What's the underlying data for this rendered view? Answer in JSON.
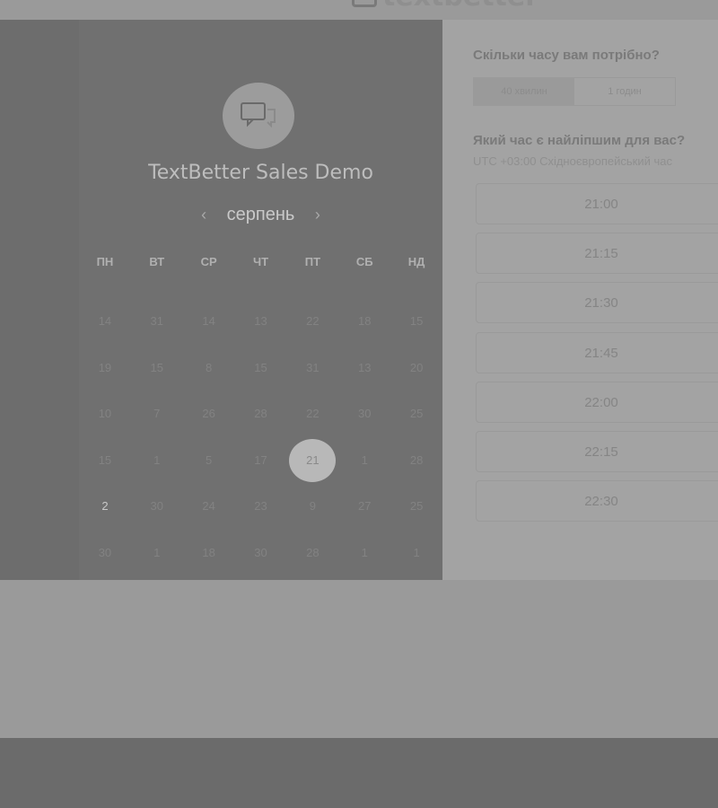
{
  "header": {
    "logo_text": "textbetter",
    "logo_icon": "chat-bubble-icon"
  },
  "event": {
    "title": "TextBetter Sales Demo",
    "icon": "chat-bubbles-icon"
  },
  "calendar": {
    "month": "серпень",
    "prev_icon": "chevron-left-icon",
    "next_icon": "chevron-right-icon",
    "weekdays": [
      "ПН",
      "ВТ",
      "СР",
      "ЧТ",
      "ПТ",
      "СБ",
      "НД"
    ],
    "rows": [
      [
        "14",
        "31",
        "14",
        "13",
        "22",
        "18",
        "15"
      ],
      [
        "19",
        "15",
        "8",
        "15",
        "31",
        "13",
        "20"
      ],
      [
        "10",
        "7",
        "26",
        "28",
        "22",
        "30",
        "25"
      ],
      [
        "15",
        "1",
        "5",
        "17",
        "21",
        "1",
        "28"
      ],
      [
        "2",
        "30",
        "24",
        "23",
        "9",
        "27",
        "25"
      ],
      [
        "30",
        "1",
        "18",
        "30",
        "28",
        "1",
        "1"
      ]
    ],
    "selected": "21",
    "highlighted": "2"
  },
  "booking": {
    "duration_question": "Скільки часу вам потрібно?",
    "durations": [
      "40 хвилин",
      "1 годин"
    ],
    "active_duration": "40 хвилин",
    "time_question": "Який час є найліпшим для вас?",
    "timezone": "UTC +03:00 Східноєвропейський час",
    "slots": [
      "21:00",
      "21:15",
      "21:30",
      "21:45",
      "22:00",
      "22:15",
      "22:30"
    ]
  }
}
